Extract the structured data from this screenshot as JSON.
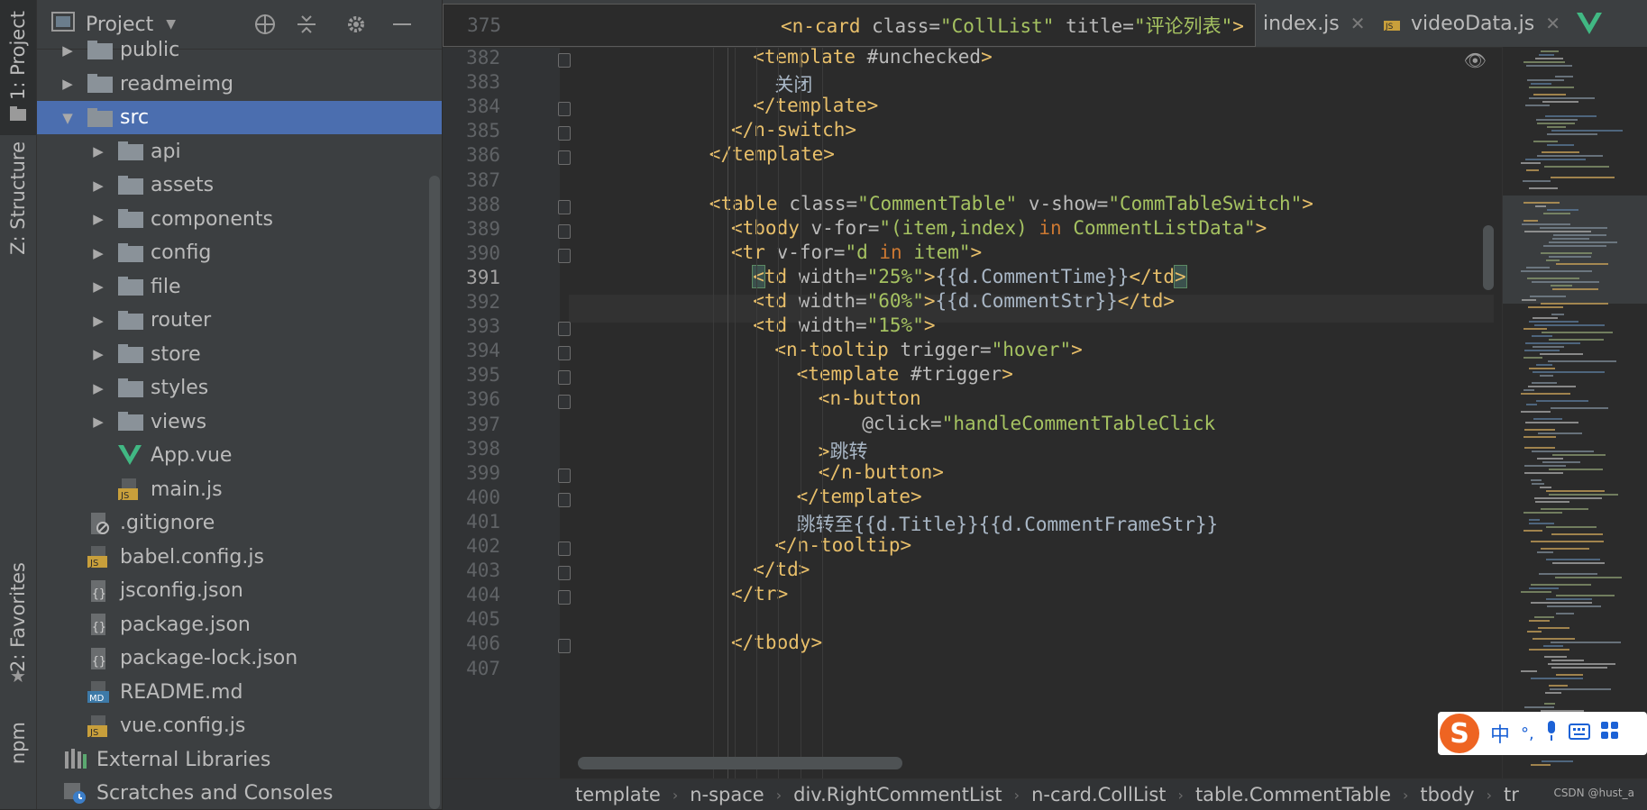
{
  "toolstrip": {
    "tabs": [
      "1: Project",
      "Z: Structure",
      "2: Favorites",
      "npm"
    ]
  },
  "project": {
    "title": "Project",
    "tree": [
      {
        "label": "public",
        "kind": "folder",
        "depth": 1,
        "expanded": false
      },
      {
        "label": "readmeimg",
        "kind": "folder",
        "depth": 1,
        "expanded": false
      },
      {
        "label": "src",
        "kind": "folder",
        "depth": 1,
        "expanded": true,
        "selected": true
      },
      {
        "label": "api",
        "kind": "folder",
        "depth": 2,
        "expanded": false
      },
      {
        "label": "assets",
        "kind": "folder",
        "depth": 2,
        "expanded": false
      },
      {
        "label": "components",
        "kind": "folder",
        "depth": 2,
        "expanded": false
      },
      {
        "label": "config",
        "kind": "folder",
        "depth": 2,
        "expanded": false
      },
      {
        "label": "file",
        "kind": "folder",
        "depth": 2,
        "expanded": false
      },
      {
        "label": "router",
        "kind": "folder",
        "depth": 2,
        "expanded": false
      },
      {
        "label": "store",
        "kind": "folder",
        "depth": 2,
        "expanded": false
      },
      {
        "label": "styles",
        "kind": "folder",
        "depth": 2,
        "expanded": false
      },
      {
        "label": "views",
        "kind": "folder",
        "depth": 2,
        "expanded": false
      },
      {
        "label": "App.vue",
        "kind": "vue",
        "depth": 2
      },
      {
        "label": "main.js",
        "kind": "js",
        "depth": 2
      },
      {
        "label": ".gitignore",
        "kind": "ignore",
        "depth": 1
      },
      {
        "label": "babel.config.js",
        "kind": "js",
        "depth": 1
      },
      {
        "label": "jsconfig.json",
        "kind": "json",
        "depth": 1
      },
      {
        "label": "package.json",
        "kind": "json",
        "depth": 1
      },
      {
        "label": "package-lock.json",
        "kind": "json",
        "depth": 1
      },
      {
        "label": "README.md",
        "kind": "md",
        "depth": 1
      },
      {
        "label": "vue.config.js",
        "kind": "js",
        "depth": 1
      },
      {
        "label": "External Libraries",
        "kind": "lib",
        "depth": 0
      },
      {
        "label": "Scratches and Consoles",
        "kind": "scratch",
        "depth": 0
      }
    ]
  },
  "tabs": [
    {
      "label": "index.js"
    },
    {
      "label": "videoData.js"
    }
  ],
  "sticky": {
    "line": "375",
    "segments": [
      {
        "t": "<n-card ",
        "c": "tag"
      },
      {
        "t": "class=",
        "c": "attr"
      },
      {
        "t": "\"CollList\" ",
        "c": "str"
      },
      {
        "t": "title=",
        "c": "attr"
      },
      {
        "t": "\"评论列表\"",
        "c": "str"
      },
      {
        "t": ">",
        "c": "tag"
      }
    ]
  },
  "code": [
    {
      "n": "382",
      "indent": 12,
      "fold": true,
      "segs": [
        {
          "t": "<template ",
          "c": "tag"
        },
        {
          "t": "#unchecked",
          "c": "attr"
        },
        {
          "t": ">",
          "c": "tag"
        }
      ]
    },
    {
      "n": "383",
      "indent": 14,
      "segs": [
        {
          "t": "关闭",
          "c": "plain"
        }
      ]
    },
    {
      "n": "384",
      "indent": 12,
      "fold": true,
      "segs": [
        {
          "t": "</template>",
          "c": "tag"
        }
      ]
    },
    {
      "n": "385",
      "indent": 10,
      "fold": true,
      "segs": [
        {
          "t": "</n-switch>",
          "c": "tag"
        }
      ]
    },
    {
      "n": "386",
      "indent": 8,
      "fold": true,
      "segs": [
        {
          "t": "</template>",
          "c": "tag"
        }
      ]
    },
    {
      "n": "387",
      "indent": 0,
      "segs": []
    },
    {
      "n": "388",
      "indent": 8,
      "fold": true,
      "segs": [
        {
          "t": "<table ",
          "c": "tag"
        },
        {
          "t": "class=",
          "c": "attr"
        },
        {
          "t": "\"CommentTable\" ",
          "c": "str"
        },
        {
          "t": "v-show=",
          "c": "attr"
        },
        {
          "t": "\"CommTableSwitch\"",
          "c": "str"
        },
        {
          "t": ">",
          "c": "tag"
        }
      ]
    },
    {
      "n": "389",
      "indent": 10,
      "fold": true,
      "segs": [
        {
          "t": "<tbody ",
          "c": "tag"
        },
        {
          "t": "v-for=",
          "c": "attr"
        },
        {
          "t": "\"(item,index) ",
          "c": "str"
        },
        {
          "t": "in ",
          "c": "kw"
        },
        {
          "t": "CommentListData\"",
          "c": "str"
        },
        {
          "t": ">",
          "c": "tag"
        }
      ]
    },
    {
      "n": "390",
      "indent": 10,
      "fold": true,
      "segs": [
        {
          "t": "<tr ",
          "c": "tag"
        },
        {
          "t": "v-for=",
          "c": "attr"
        },
        {
          "t": "\"d ",
          "c": "str"
        },
        {
          "t": "in ",
          "c": "kw"
        },
        {
          "t": "item\"",
          "c": "str"
        },
        {
          "t": ">",
          "c": "tag"
        }
      ]
    },
    {
      "n": "391",
      "indent": 12,
      "cur": true,
      "segs": [
        {
          "t": "<",
          "c": "brk"
        },
        {
          "t": "td ",
          "c": "tag"
        },
        {
          "t": "width=",
          "c": "attr"
        },
        {
          "t": "\"25%\"",
          "c": "str"
        },
        {
          "t": ">",
          "c": "tag"
        },
        {
          "t": "{{d.CommentTime}}",
          "c": "plain"
        },
        {
          "t": "</td",
          "c": "tag"
        },
        {
          "t": ">",
          "c": "brk"
        }
      ]
    },
    {
      "n": "392",
      "indent": 12,
      "segs": [
        {
          "t": "<td ",
          "c": "tag"
        },
        {
          "t": "width=",
          "c": "attr"
        },
        {
          "t": "\"60%\"",
          "c": "str"
        },
        {
          "t": ">",
          "c": "tag"
        },
        {
          "t": "{{d.CommentStr}}",
          "c": "plain"
        },
        {
          "t": "</td>",
          "c": "tag"
        }
      ]
    },
    {
      "n": "393",
      "indent": 12,
      "fold": true,
      "segs": [
        {
          "t": "<td ",
          "c": "tag"
        },
        {
          "t": "width=",
          "c": "attr"
        },
        {
          "t": "\"15%\"",
          "c": "str"
        },
        {
          "t": ">",
          "c": "tag"
        }
      ]
    },
    {
      "n": "394",
      "indent": 14,
      "fold": true,
      "segs": [
        {
          "t": "<n-tooltip ",
          "c": "tag"
        },
        {
          "t": "trigger=",
          "c": "attr"
        },
        {
          "t": "\"hover\"",
          "c": "str"
        },
        {
          "t": ">",
          "c": "tag"
        }
      ]
    },
    {
      "n": "395",
      "indent": 16,
      "fold": true,
      "segs": [
        {
          "t": "<template ",
          "c": "tag"
        },
        {
          "t": "#trigger",
          "c": "attr"
        },
        {
          "t": ">",
          "c": "tag"
        }
      ]
    },
    {
      "n": "396",
      "indent": 18,
      "fold": true,
      "segs": [
        {
          "t": "<n-button",
          "c": "tag"
        }
      ]
    },
    {
      "n": "397",
      "indent": 22,
      "segs": [
        {
          "t": "@click=",
          "c": "attr"
        },
        {
          "t": "\"handleCommentTableClick",
          "c": "str"
        }
      ]
    },
    {
      "n": "398",
      "indent": 18,
      "segs": [
        {
          "t": ">",
          "c": "tag"
        },
        {
          "t": "跳转",
          "c": "plain"
        }
      ]
    },
    {
      "n": "399",
      "indent": 18,
      "fold": true,
      "segs": [
        {
          "t": "</n-button>",
          "c": "tag"
        }
      ]
    },
    {
      "n": "400",
      "indent": 16,
      "fold": true,
      "segs": [
        {
          "t": "</template>",
          "c": "tag"
        }
      ]
    },
    {
      "n": "401",
      "indent": 16,
      "segs": [
        {
          "t": "跳转至{{d.Title}}{{d.CommentFrameStr}}",
          "c": "plain"
        }
      ]
    },
    {
      "n": "402",
      "indent": 14,
      "fold": true,
      "segs": [
        {
          "t": "</n-tooltip>",
          "c": "tag"
        }
      ]
    },
    {
      "n": "403",
      "indent": 12,
      "fold": true,
      "segs": [
        {
          "t": "</td>",
          "c": "tag"
        }
      ]
    },
    {
      "n": "404",
      "indent": 10,
      "fold": true,
      "segs": [
        {
          "t": "</tr>",
          "c": "tag"
        }
      ]
    },
    {
      "n": "405",
      "indent": 0,
      "segs": []
    },
    {
      "n": "406",
      "indent": 10,
      "fold": true,
      "segs": [
        {
          "t": "</tbody>",
          "c": "tag"
        }
      ]
    },
    {
      "n": "407",
      "indent": 0,
      "segs": []
    }
  ],
  "breadcrumb": [
    "template",
    "n-space",
    "div.RightCommentList",
    "n-card.CollList",
    "table.CommentTable",
    "tbody",
    "tr"
  ],
  "watermark": "CSDN @hust_a",
  "ime": {
    "logo": "S",
    "lang": "中",
    "punct": "°,"
  },
  "colors": {
    "accent": "#4b6eaf",
    "tag": "#e8bf6a",
    "string": "#a5c261",
    "keyword": "#cc7832"
  }
}
